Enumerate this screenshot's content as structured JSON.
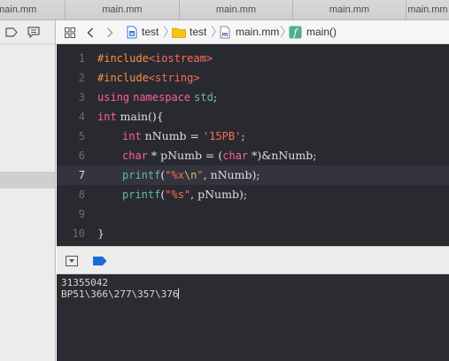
{
  "tabs": [
    {
      "label": "main.mm"
    },
    {
      "label": "main.mm"
    },
    {
      "label": "main.mm"
    },
    {
      "label": "main.mm"
    },
    {
      "label": "main.mm"
    }
  ],
  "jumpbar": {
    "project": "test",
    "group": "test",
    "file": "main.mm",
    "symbol": "main()"
  },
  "editor": {
    "current_line": 7,
    "lines": [
      {
        "number": "1"
      },
      {
        "number": "2"
      },
      {
        "number": "3"
      },
      {
        "number": "4"
      },
      {
        "number": "5"
      },
      {
        "number": "6"
      },
      {
        "number": "7"
      },
      {
        "number": "8"
      },
      {
        "number": "9"
      },
      {
        "number": "10"
      }
    ],
    "code": {
      "l1_directive": "#include",
      "l1_header": "<iostream>",
      "l2_directive": "#include",
      "l2_header": "<string>",
      "l3_using": "using",
      "l3_namespace": "namespace",
      "l3_std": "std",
      "l3_semi": ";",
      "l4_int": "int",
      "l4_rest": " main(){",
      "l5_int": "int",
      "l5_mid": " nNumb = ",
      "l5_str": "'15PB'",
      "l5_semi": ";",
      "l6_char": "char",
      "l6_mid": " * pNumb = (",
      "l6_char2": "char",
      "l6_end": " *)&nNumb;",
      "l7_fn": "printf",
      "l7_open": "(",
      "l7_q1": "\"%x",
      "l7_esc": "\\n",
      "l7_q2": "\"",
      "l7_end": ", nNumb);",
      "l8_fn": "printf",
      "l8_open": "(",
      "l8_str": "\"%s\"",
      "l8_end": ", pNumb);",
      "l10_close": "}"
    }
  },
  "console": {
    "lines": [
      {
        "text": "31355042"
      },
      {
        "text": "BP51\\366\\277\\357\\376"
      }
    ]
  },
  "icons": {
    "nav_left": "rectangle-outline-icon",
    "nav_right": "speech-bubble-icon",
    "related": "grid-icon",
    "back": "chevron-left-icon",
    "forward": "chevron-right-icon",
    "project": "xcode-project-icon",
    "group": "folder-icon",
    "file": "objc-file-icon",
    "symbol": "function-icon",
    "debug_hide": "hide-debug-area-icon",
    "breakpoint": "breakpoint-toggle-icon"
  },
  "colors": {
    "keyword": "#fc5fa3",
    "preprocessor": "#fd8f3f",
    "string": "#fc6a5d",
    "function": "#67b7a4",
    "escape": "#d0bf69",
    "editor_background": "#292a30",
    "breakpoint_accent": "#1a6bd8"
  }
}
